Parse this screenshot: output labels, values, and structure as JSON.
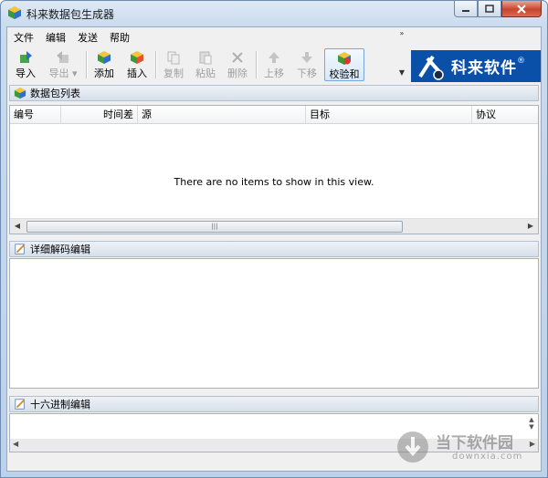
{
  "window": {
    "title": "科来数据包生成器"
  },
  "menu": [
    "文件",
    "编辑",
    "发送",
    "帮助"
  ],
  "toolbar": {
    "import": "导入",
    "export": "导出",
    "add": "添加",
    "insert": "插入",
    "copy": "复制",
    "paste": "粘贴",
    "delete": "删除",
    "move_up": "上移",
    "move_down": "下移",
    "checksum": "校验和"
  },
  "logo": {
    "text": "科来软件"
  },
  "packet_list": {
    "title": "数据包列表",
    "columns": [
      "编号",
      "时间差",
      "源",
      "目标",
      "协议"
    ],
    "empty_message": "There are no items to show in this view."
  },
  "decode_panel": {
    "title": "详细解码编辑"
  },
  "hex_panel": {
    "title": "十六进制编辑"
  },
  "watermark": {
    "main": "当下软件园",
    "sub": "downxia.com"
  },
  "colors": {
    "accent": "#0a4fa8",
    "close_button": "#c8442d"
  }
}
